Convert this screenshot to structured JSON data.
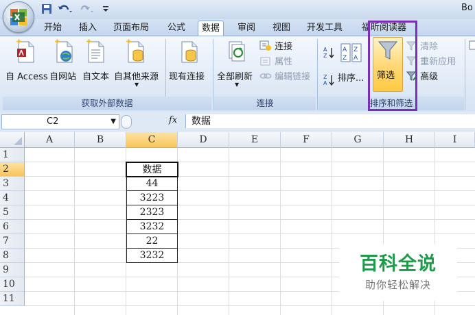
{
  "window": {
    "title": "Bo"
  },
  "tabs": [
    "开始",
    "插入",
    "页面布局",
    "公式",
    "数据",
    "审阅",
    "视图",
    "开发工具",
    "福昕阅读器"
  ],
  "active_tab": "数据",
  "ribbon": {
    "external_data": {
      "label": "获取外部数据",
      "buttons": [
        "自 Access",
        "自网站",
        "自文本",
        "自其他来源",
        "现有连接"
      ]
    },
    "connections": {
      "label": "连接",
      "refresh_all": "全部刷新",
      "connections": "连接",
      "properties": "属性",
      "edit_links": "编辑链接"
    },
    "sort_filter": {
      "label": "排序和筛选",
      "sort": "排序...",
      "filter": "筛选",
      "clear": "清除",
      "reapply": "重新应用",
      "advanced": "高级"
    },
    "highlight_color": "#7b2fb8"
  },
  "formula_bar": {
    "name_box": "C2",
    "fx": "fx",
    "content": "数据"
  },
  "columns": [
    "A",
    "B",
    "C",
    "D",
    "E",
    "F",
    "G",
    "H",
    "I"
  ],
  "rows": [
    "1",
    "2",
    "3",
    "4",
    "5",
    "6",
    "7",
    "8",
    "9",
    "10",
    "11"
  ],
  "cells": {
    "C2": "数据",
    "C3": "44",
    "C4": "3223",
    "C5": "2323",
    "C6": "3232",
    "C7": "22",
    "C8": "3232"
  },
  "selected_cell": "C2",
  "watermark": {
    "title": "百科全说",
    "subtitle": "助你轻松解决",
    "color": "#1e9a4a"
  }
}
